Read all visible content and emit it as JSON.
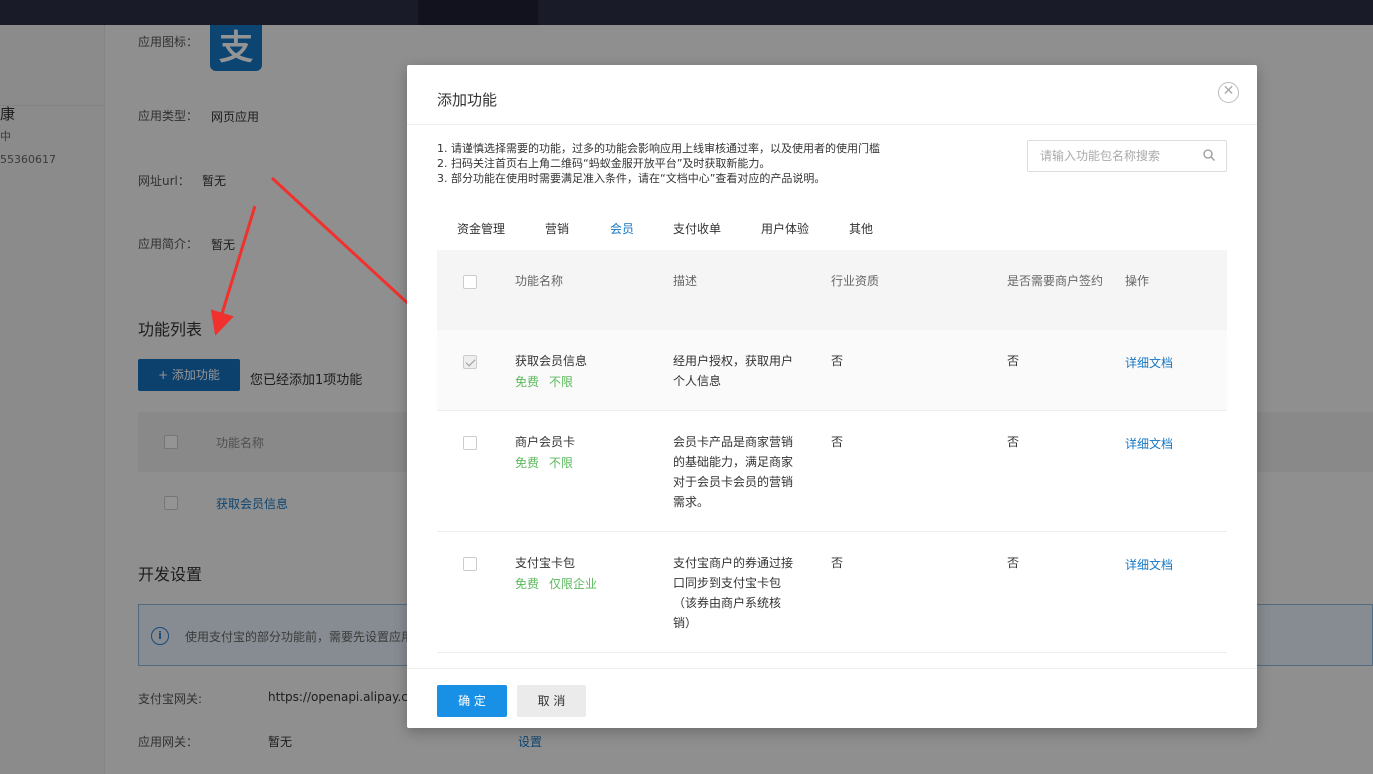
{
  "background": {
    "app_icon_label": "应用图标：",
    "app_icon_glyph": "支",
    "app_type_label": "应用类型：",
    "app_type_value": "网页应用",
    "url_label": "网址url：",
    "url_value": "暂无",
    "intro_label": "应用简介：",
    "intro_value": "暂无",
    "left_name": "康",
    "left_status": "中",
    "left_id": "55360617",
    "feature_list_title": "功能列表",
    "add_button": "+ 添加功能",
    "added_count_text": "您已经添加1项功能",
    "table_header_name": "功能名称",
    "table_row_link": "获取会员信息",
    "dev_settings_title": "开发设置",
    "alert_icon": "i",
    "alert_text": "使用支付宝的部分功能前，需要先设置应用",
    "gateway_label": "支付宝网关:",
    "gateway_value": "https://openapi.alipay.co",
    "app_gateway_label": "应用网关：",
    "app_gateway_value": "暂无",
    "app_gateway_link": "设置"
  },
  "modal": {
    "title": "添加功能",
    "close_symbol": "✕",
    "tips": [
      "1. 请谨慎选择需要的功能，过多的功能会影响应用上线审核通过率，以及使用者的使用门槛",
      "2. 扫码关注首页右上角二维码“蚂蚁金服开放平台”及时获取新能力。",
      "3. 部分功能在使用时需要满足准入条件，请在“文档中心”查看对应的产品说明。"
    ],
    "search_placeholder": "请输入功能包名称搜索",
    "tabs": [
      {
        "label": "资金管理",
        "active": false
      },
      {
        "label": "营销",
        "active": false
      },
      {
        "label": "会员",
        "active": true
      },
      {
        "label": "支付收单",
        "active": false
      },
      {
        "label": "用户体验",
        "active": false
      },
      {
        "label": "其他",
        "active": false
      }
    ],
    "columns": {
      "name": "功能名称",
      "desc": "描述",
      "qualification": "行业资质",
      "sign": "是否需要商户签约",
      "action": "操作"
    },
    "rows": [
      {
        "name": "获取会员信息",
        "tag1": "免费",
        "tag2": "不限",
        "desc": "经用户授权，获取用户个人信息",
        "qualification": "否",
        "sign": "否",
        "action": "详细文档",
        "checked": true
      },
      {
        "name": "商户会员卡",
        "tag1": "免费",
        "tag2": "不限",
        "desc": "会员卡产品是商家营销的基础能力，满足商家对于会员卡会员的营销需求。",
        "qualification": "否",
        "sign": "否",
        "action": "详细文档",
        "checked": false
      },
      {
        "name": "支付宝卡包",
        "tag1": "免费",
        "tag2": "仅限企业",
        "desc": "支付宝商户的券通过接口同步到支付宝卡包（该券由商户系统核销）",
        "qualification": "否",
        "sign": "否",
        "action": "详细文档",
        "checked": false
      }
    ],
    "ok_button": "确 定",
    "cancel_button": "取 消"
  },
  "colors": {
    "accent": "#1677c4",
    "primary_button": "#1890e6",
    "tag_green": "#5cb85c",
    "arrow_red": "#f0312d",
    "topbar": "#2d2f45"
  }
}
